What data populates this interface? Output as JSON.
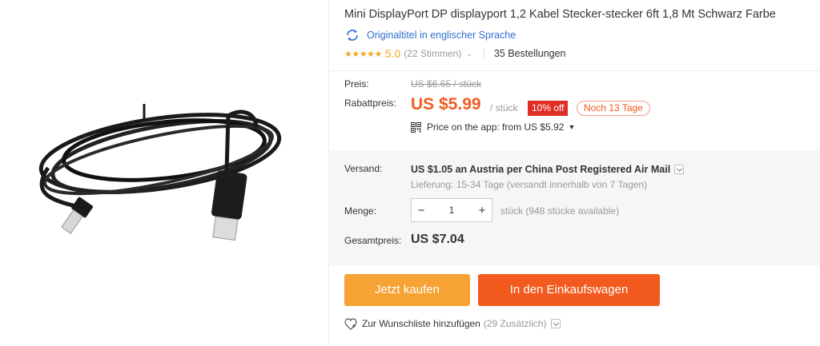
{
  "product": {
    "title": "Mini DisplayPort DP displayport 1,2 Kabel Stecker-stecker 6ft 1,8 Mt Schwarz Farbe",
    "original_title_link": "Originaltitel in englischer Sprache",
    "stars": "★★★★★",
    "rating": "5.0",
    "votes": "(22 Stimmen)",
    "orders": "35 Bestellungen"
  },
  "pricing": {
    "price_label": "Preis:",
    "old_price": "US $6.65 / stück",
    "discount_label": "Rabattpreis:",
    "new_price": "US $5.99",
    "per_unit": "/ stück",
    "discount_badge": "10% off",
    "days_left": "Noch 13 Tage",
    "app_price": "Price on the app: from US $5.92"
  },
  "shipping": {
    "label": "Versand:",
    "value": "US $1.05 an Austria per China Post Registered Air Mail",
    "delivery": "Lieferung: 15-34 Tage (versandt innerhalb von 7 Tagen)"
  },
  "quantity": {
    "label": "Menge:",
    "minus": "−",
    "value": "1",
    "plus": "+",
    "stock": "stück (948 stücke available)"
  },
  "total": {
    "label": "Gesamtpreis:",
    "value": "US $7.04"
  },
  "actions": {
    "buy_now": "Jetzt kaufen",
    "add_to_cart": "In den Einkaufswagen",
    "wishlist": "Zur Wunschliste hinzufügen",
    "wishlist_count": "(29 Zusätzlich)"
  },
  "icons": {
    "translate": "translate-icon",
    "qr": "qr-code-icon",
    "heart": "heart-icon"
  },
  "colors": {
    "accent_orange": "#f25a1e",
    "buy_button": "#f6a234",
    "star": "#f6a623",
    "badge_red": "#e02e24",
    "link_blue": "#2e6fd1"
  }
}
